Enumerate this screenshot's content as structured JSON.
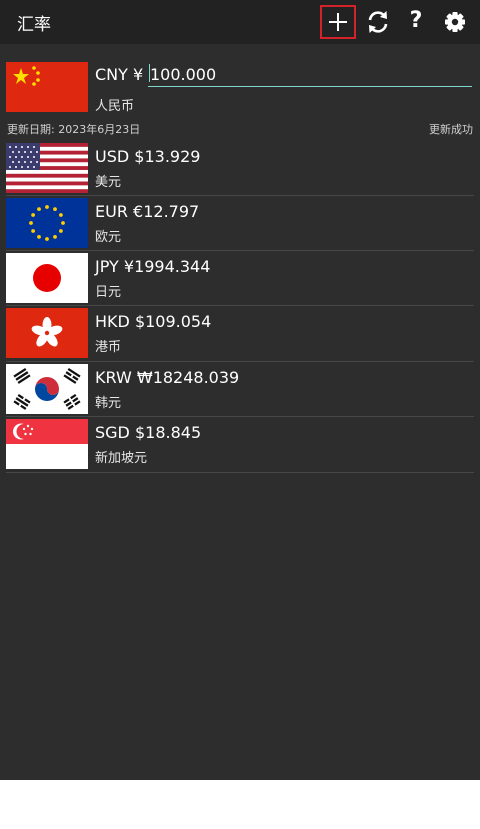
{
  "app": {
    "title": "汇率"
  },
  "toolbar": {
    "add_icon": "plus-icon",
    "refresh_icon": "refresh-icon",
    "help_label": "?",
    "settings_icon": "gear-icon",
    "highlight_color": "#d4222a"
  },
  "base": {
    "code": "CNY ¥",
    "amount": "100.000",
    "name": "人民币"
  },
  "update": {
    "date_label": "更新日期: 2023年6月23日",
    "status": "更新成功"
  },
  "rates": [
    {
      "code": "USD",
      "value": "$13.929",
      "name": "美元",
      "flag": "us-flag"
    },
    {
      "code": "EUR",
      "value": "€12.797",
      "name": "欧元",
      "flag": "eu-flag"
    },
    {
      "code": "JPY",
      "value": "¥1994.344",
      "name": "日元",
      "flag": "jp-flag"
    },
    {
      "code": "HKD",
      "value": "$109.054",
      "name": "港币",
      "flag": "hk-flag"
    },
    {
      "code": "KRW",
      "value": "₩18248.039",
      "name": "韩元",
      "flag": "kr-flag"
    },
    {
      "code": "SGD",
      "value": "$18.845",
      "name": "新加坡元",
      "flag": "sg-flag"
    }
  ],
  "colors": {
    "background": "#2d2d2d",
    "toolbar": "#222222",
    "accent": "#7fd6cc"
  }
}
